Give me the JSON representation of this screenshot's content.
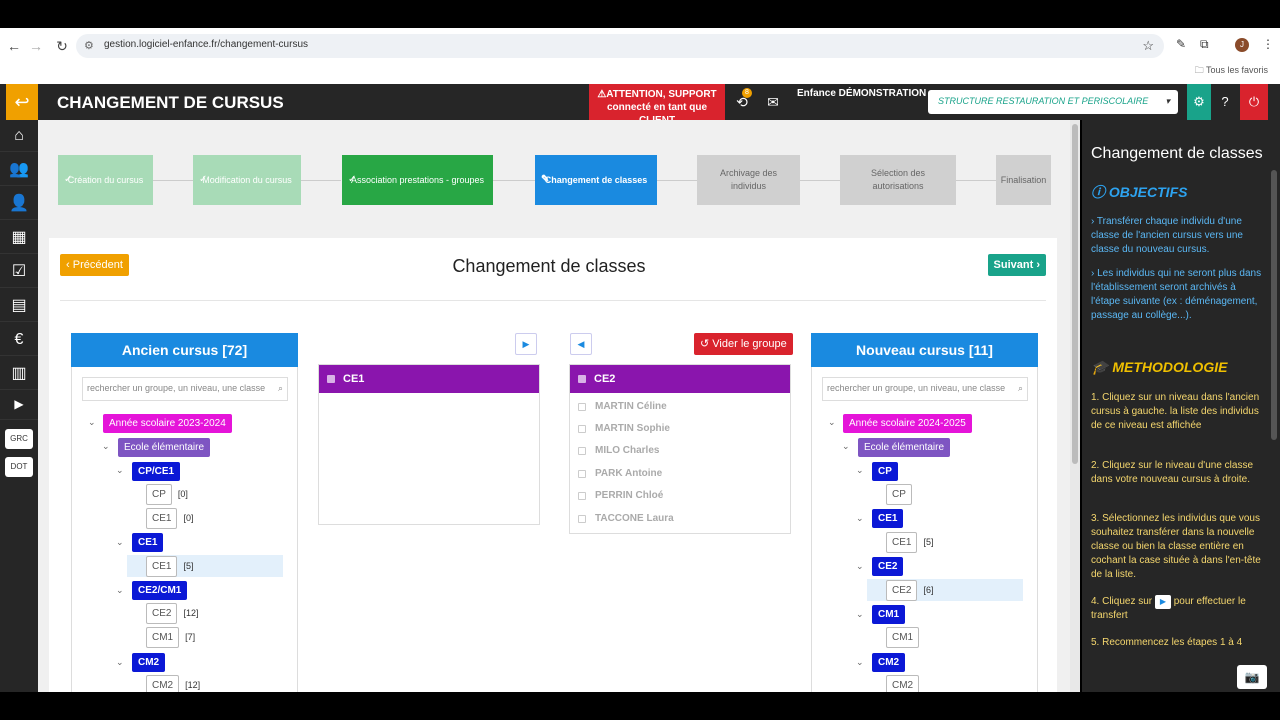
{
  "browser": {
    "url": "gestion.logiciel-enfance.fr/changement-cursus",
    "bookmarks_label": "Tous les favoris",
    "avatar_initial": "J"
  },
  "app": {
    "title": "CHANGEMENT DE CURSUS",
    "alert_line1": "ATTENTION, SUPPORT",
    "alert_line2": "connecté en tant que CLIENT",
    "badge_count": "8",
    "org": "Enfance DÉMONSTRATION",
    "structure": "STRUCTURE RESTAURATION ET PERISCOLAIRE"
  },
  "sidebar": {
    "grc": "GRC",
    "dot": "DOT"
  },
  "steps": [
    {
      "label": "Création du cursus",
      "state": "done"
    },
    {
      "label": "Modification du cursus",
      "state": "done"
    },
    {
      "label": "Association prestations - groupes",
      "state": "current-done"
    },
    {
      "label": "Changement de classes",
      "state": "active"
    },
    {
      "label": "Archivage des individus",
      "state": "todo"
    },
    {
      "label": "Sélection des autorisations",
      "state": "todo"
    },
    {
      "label": "Finalisation",
      "state": "todo"
    }
  ],
  "card": {
    "prev_label": "Précédent",
    "next_label": "Suivant",
    "title": "Changement de classes",
    "clear_group_label": "Vider le groupe"
  },
  "ancien": {
    "title": "Ancien cursus [72]",
    "search_placeholder": "rechercher un groupe, un niveau, une classe",
    "year": "Année scolaire 2023-2024",
    "school": "Ecole élémentaire",
    "levels": [
      {
        "name": "CP/CE1",
        "classes": [
          {
            "name": "CP",
            "count": "[0]"
          },
          {
            "name": "CE1",
            "count": "[0]"
          }
        ]
      },
      {
        "name": "CE1",
        "classes": [
          {
            "name": "CE1",
            "count": "[5]"
          }
        ]
      },
      {
        "name": "CE2/CM1",
        "classes": [
          {
            "name": "CE2",
            "count": "[12]"
          },
          {
            "name": "CM1",
            "count": "[7]"
          }
        ]
      },
      {
        "name": "CM2",
        "classes": [
          {
            "name": "CM2",
            "count": "[12]"
          }
        ]
      }
    ]
  },
  "middle_left": {
    "group": "CE1"
  },
  "middle_right": {
    "group": "CE2",
    "students": [
      "MARTIN Céline",
      "MARTIN Sophie",
      "MILO Charles",
      "PARK Antoine",
      "PERRIN Chloé",
      "TACCONE Laura"
    ]
  },
  "nouveau": {
    "title": "Nouveau cursus [11]",
    "search_placeholder": "rechercher un groupe, un niveau, une classe",
    "year": "Année scolaire 2024-2025",
    "school": "Ecole élémentaire",
    "levels": [
      {
        "name": "CP",
        "classes": [
          {
            "name": "CP",
            "count": ""
          }
        ]
      },
      {
        "name": "CE1",
        "classes": [
          {
            "name": "CE1",
            "count": "[5]"
          }
        ]
      },
      {
        "name": "CE2",
        "classes": [
          {
            "name": "CE2",
            "count": "[6]"
          }
        ]
      },
      {
        "name": "CM1",
        "classes": [
          {
            "name": "CM1",
            "count": ""
          }
        ]
      },
      {
        "name": "CM2",
        "classes": [
          {
            "name": "CM2",
            "count": ""
          }
        ]
      }
    ]
  },
  "help": {
    "title": "Changement de classes",
    "objectifs_title": "OBJECTIFS",
    "objectif1": "› Transférer chaque individu d'une classe de l'ancien cursus vers une classe du nouveau cursus.",
    "objectif2": "› Les individus qui ne seront plus dans l'établissement seront archivés à l'étape suivante (ex : déménagement, passage au collège...).",
    "methodo_title": "METHODOLOGIE",
    "m1": "1. Cliquez sur un niveau dans l'ancien cursus à gauche. la liste des individus de ce niveau est affichée",
    "m2": "2. Cliquez sur le niveau d'une classe dans votre nouveau cursus à droite.",
    "m3": "3. Sélectionnez les individus que vous souhaitez transférer dans la nouvelle classe ou bien la classe entière en cochant la case située à dans l'en-tête de la liste.",
    "m4a": "4. Cliquez sur",
    "m4b": "pour effectuer le transfert",
    "m5": "5. Recommencez les étapes 1 à 4"
  }
}
